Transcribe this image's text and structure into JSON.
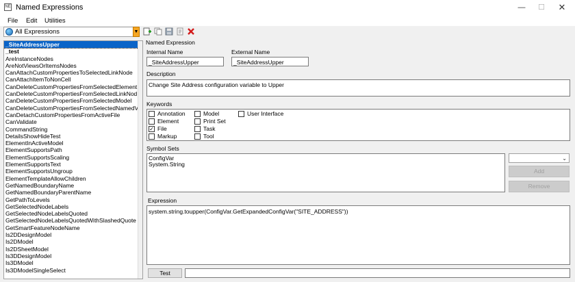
{
  "window": {
    "title": "Named Expressions",
    "app_icon_text": "NE"
  },
  "menu": {
    "items": [
      "File",
      "Edit",
      "Utilities"
    ]
  },
  "filter": {
    "selected": "All Expressions"
  },
  "toolbar": {
    "icons": [
      "new-expression-icon",
      "copy-expression-icon",
      "save-icon",
      "properties-icon",
      "delete-icon"
    ]
  },
  "list": {
    "items": [
      "_SiteAddressUpper",
      "_test",
      "AreInstanceNodes",
      "AreNotViewsOrItemsNodes",
      "CanAttachCustomPropertiesToSelectedLinkNode",
      "CanAttachItemToNonCell",
      "CanDeleteCustomPropertiesFromSelectedElement",
      "CanDeleteCustomPropertiesFromSelectedLinkNod",
      "CanDeleteCustomPropertiesFromSelectedModel",
      "CanDeleteCustomPropertiesFromSelectedNamedV",
      "CanDetachCustomPropertiesFromActiveFile",
      "CanValidate",
      "CommandString",
      "DetailsShowHideTest",
      "ElementInActiveModel",
      "ElementSupportsPath",
      "ElementSupportsScaling",
      "ElementSupportsText",
      "ElementSupportsUngroup",
      "ElementTemplateAllowChildren",
      "GetNamedBoundaryName",
      "GetNamedBoundaryParentName",
      "GetPathToLevels",
      "GetSelectedNodeLabels",
      "GetSelectedNodeLabelsQuoted",
      "GetSelectedNodeLabelsQuotedWithSlashedQuote",
      "GetSmartFeatureNodeName",
      "Is2DDesignModel",
      "Is2DModel",
      "Is2DSheetModel",
      "Is3DDesignModel",
      "Is3DModel",
      "Is3DModelSingleSelect"
    ]
  },
  "detail": {
    "group_title": "Named Expression",
    "internal_name_label": "Internal Name",
    "internal_name": "_SiteAddressUpper",
    "external_name_label": "External Name",
    "external_name": "_SiteAddressUpper",
    "description_label": "Description",
    "description": "Change Site Address configuration variable to Upper",
    "keywords_label": "Keywords",
    "keywords": [
      {
        "label": "Annotation",
        "checked": false
      },
      {
        "label": "Element",
        "checked": false
      },
      {
        "label": "File",
        "checked": true
      },
      {
        "label": "Markup",
        "checked": false
      },
      {
        "label": "Model",
        "checked": false
      },
      {
        "label": "Print Set",
        "checked": false
      },
      {
        "label": "Task",
        "checked": false
      },
      {
        "label": "Tool",
        "checked": false
      },
      {
        "label": "User Interface",
        "checked": false
      }
    ],
    "symbol_sets_label": "Symbol Sets",
    "symbol_sets": [
      "ConfigVar",
      "System.String"
    ],
    "symbol_select": "",
    "add_label": "Add",
    "remove_label": "Remove",
    "expression_label": "Expression",
    "expression": "system.string.toupper(ConfigVar.GetExpandedConfigVar(\"SITE_ADDRESS\"))",
    "test_label": "Test",
    "test_result": ""
  }
}
